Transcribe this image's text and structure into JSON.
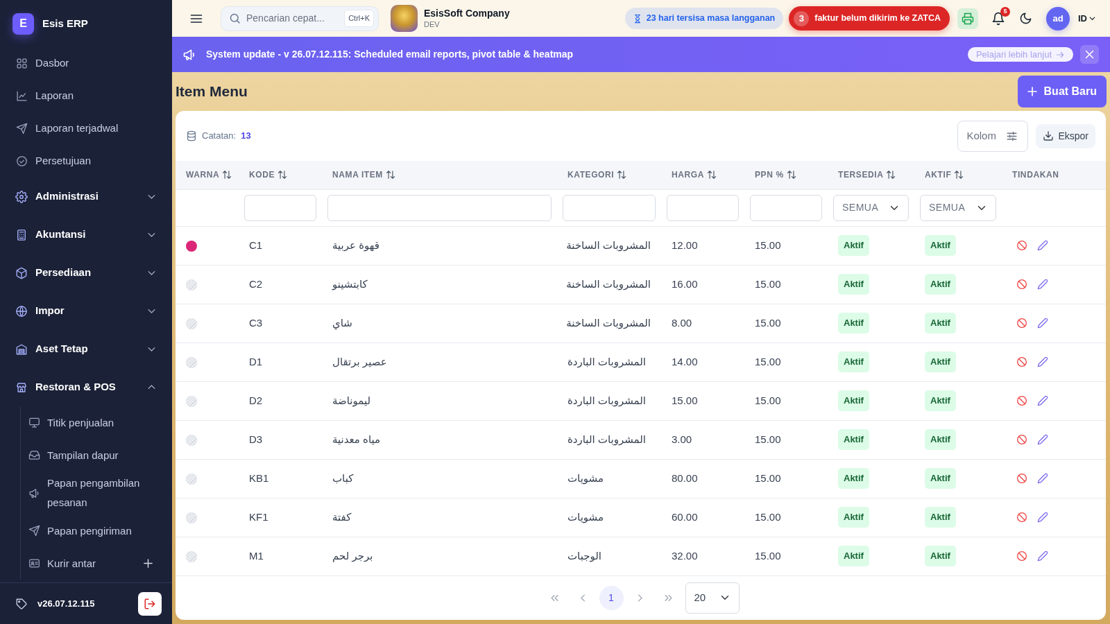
{
  "sidebar": {
    "brand": {
      "initial": "E",
      "name": "Esis ERP"
    },
    "items": [
      {
        "kind": "link",
        "label": "Dasbor"
      },
      {
        "kind": "link",
        "label": "Laporan"
      },
      {
        "kind": "link",
        "label": "Laporan terjadwal"
      },
      {
        "kind": "link",
        "label": "Persetujuan"
      },
      {
        "kind": "group",
        "label": "Administrasi",
        "expanded": false
      },
      {
        "kind": "group",
        "label": "Akuntansi",
        "expanded": false
      },
      {
        "kind": "group",
        "label": "Persediaan",
        "expanded": false
      },
      {
        "kind": "group",
        "label": "Impor",
        "expanded": false
      },
      {
        "kind": "group",
        "label": "Aset Tetap",
        "expanded": false
      },
      {
        "kind": "group",
        "label": "Restoran & POS",
        "expanded": true,
        "children": [
          {
            "label": "Titik penjualan",
            "addable": false
          },
          {
            "label": "Tampilan dapur",
            "addable": false
          },
          {
            "label": "Papan pengambilan pesanan",
            "addable": false
          },
          {
            "label": "Papan pengiriman",
            "addable": false
          },
          {
            "label": "Kurir antar",
            "addable": true
          }
        ]
      }
    ],
    "version": "v26.07.12.115"
  },
  "topbar": {
    "search": {
      "placeholder": "Pencarian cepat...",
      "shortcut": "Ctrl+K"
    },
    "company": {
      "name": "EsisSoft Company",
      "environment": "DEV"
    },
    "subscription_notice": "23 hari tersisa masa langganan",
    "zatca": {
      "count": "3",
      "text": "faktur belum dikirim ke ZATCA"
    },
    "notification_count": "5",
    "avatar_initials": "ad",
    "language": "ID"
  },
  "banner": {
    "message": "System update - v 26.07.12.115: Scheduled email reports, pivot table & heatmap",
    "link": "Pelajari lebih lanjut"
  },
  "page": {
    "title": "Item Menu",
    "create_button": "Buat Baru"
  },
  "table": {
    "records_label": "Catatan:",
    "records_count": "13",
    "columns_button": "Kolom",
    "export_button": "Ekspor",
    "columns": [
      {
        "label": "WARNA",
        "sortable": true
      },
      {
        "label": "KODE",
        "sortable": true,
        "filter": {
          "kind": "text"
        }
      },
      {
        "label": "NAMA ITEM",
        "sortable": true,
        "filter": {
          "kind": "text"
        }
      },
      {
        "label": "KATEGORI",
        "sortable": true,
        "filter": {
          "kind": "text"
        }
      },
      {
        "label": "HARGA",
        "sortable": true,
        "filter": {
          "kind": "text"
        }
      },
      {
        "label": "PPN %",
        "sortable": true,
        "filter": {
          "kind": "text"
        }
      },
      {
        "label": "TERSEDIA",
        "sortable": true,
        "filter": {
          "kind": "select",
          "value": "SEMUA"
        }
      },
      {
        "label": "AKTIF",
        "sortable": true,
        "filter": {
          "kind": "select",
          "value": "SEMUA"
        }
      },
      {
        "label": "TINDAKAN",
        "sortable": false
      }
    ],
    "rows": [
      {
        "color": "#db2777",
        "code": "C1",
        "name": "قهوة عربية",
        "category": "المشروبات الساخنة",
        "price": "12.00",
        "vat": "15.00",
        "available": "Aktif",
        "active": "Aktif"
      },
      {
        "code": "C2",
        "name": "كابتشينو",
        "category": "المشروبات الساخنة",
        "price": "16.00",
        "vat": "15.00",
        "available": "Aktif",
        "active": "Aktif"
      },
      {
        "code": "C3",
        "name": "شاي",
        "category": "المشروبات الساخنة",
        "price": "8.00",
        "vat": "15.00",
        "available": "Aktif",
        "active": "Aktif"
      },
      {
        "code": "D1",
        "name": "عصير برتقال",
        "category": "المشروبات الباردة",
        "price": "14.00",
        "vat": "15.00",
        "available": "Aktif",
        "active": "Aktif"
      },
      {
        "code": "D2",
        "name": "ليموناضة",
        "category": "المشروبات الباردة",
        "price": "15.00",
        "vat": "15.00",
        "available": "Aktif",
        "active": "Aktif"
      },
      {
        "code": "D3",
        "name": "مياه معدنية",
        "category": "المشروبات الباردة",
        "price": "3.00",
        "vat": "15.00",
        "available": "Aktif",
        "active": "Aktif"
      },
      {
        "code": "KB1",
        "name": "كباب",
        "category": "مشويات",
        "price": "80.00",
        "vat": "15.00",
        "available": "Aktif",
        "active": "Aktif"
      },
      {
        "code": "KF1",
        "name": "كفتة",
        "category": "مشويات",
        "price": "60.00",
        "vat": "15.00",
        "available": "Aktif",
        "active": "Aktif"
      },
      {
        "code": "M1",
        "name": "برجر لحم",
        "category": "الوجبات",
        "price": "32.00",
        "vat": "15.00",
        "available": "Aktif",
        "active": "Aktif"
      }
    ],
    "pagination": {
      "pages": [
        {
          "label": "1",
          "selected": true
        }
      ],
      "page_size": "20"
    }
  }
}
